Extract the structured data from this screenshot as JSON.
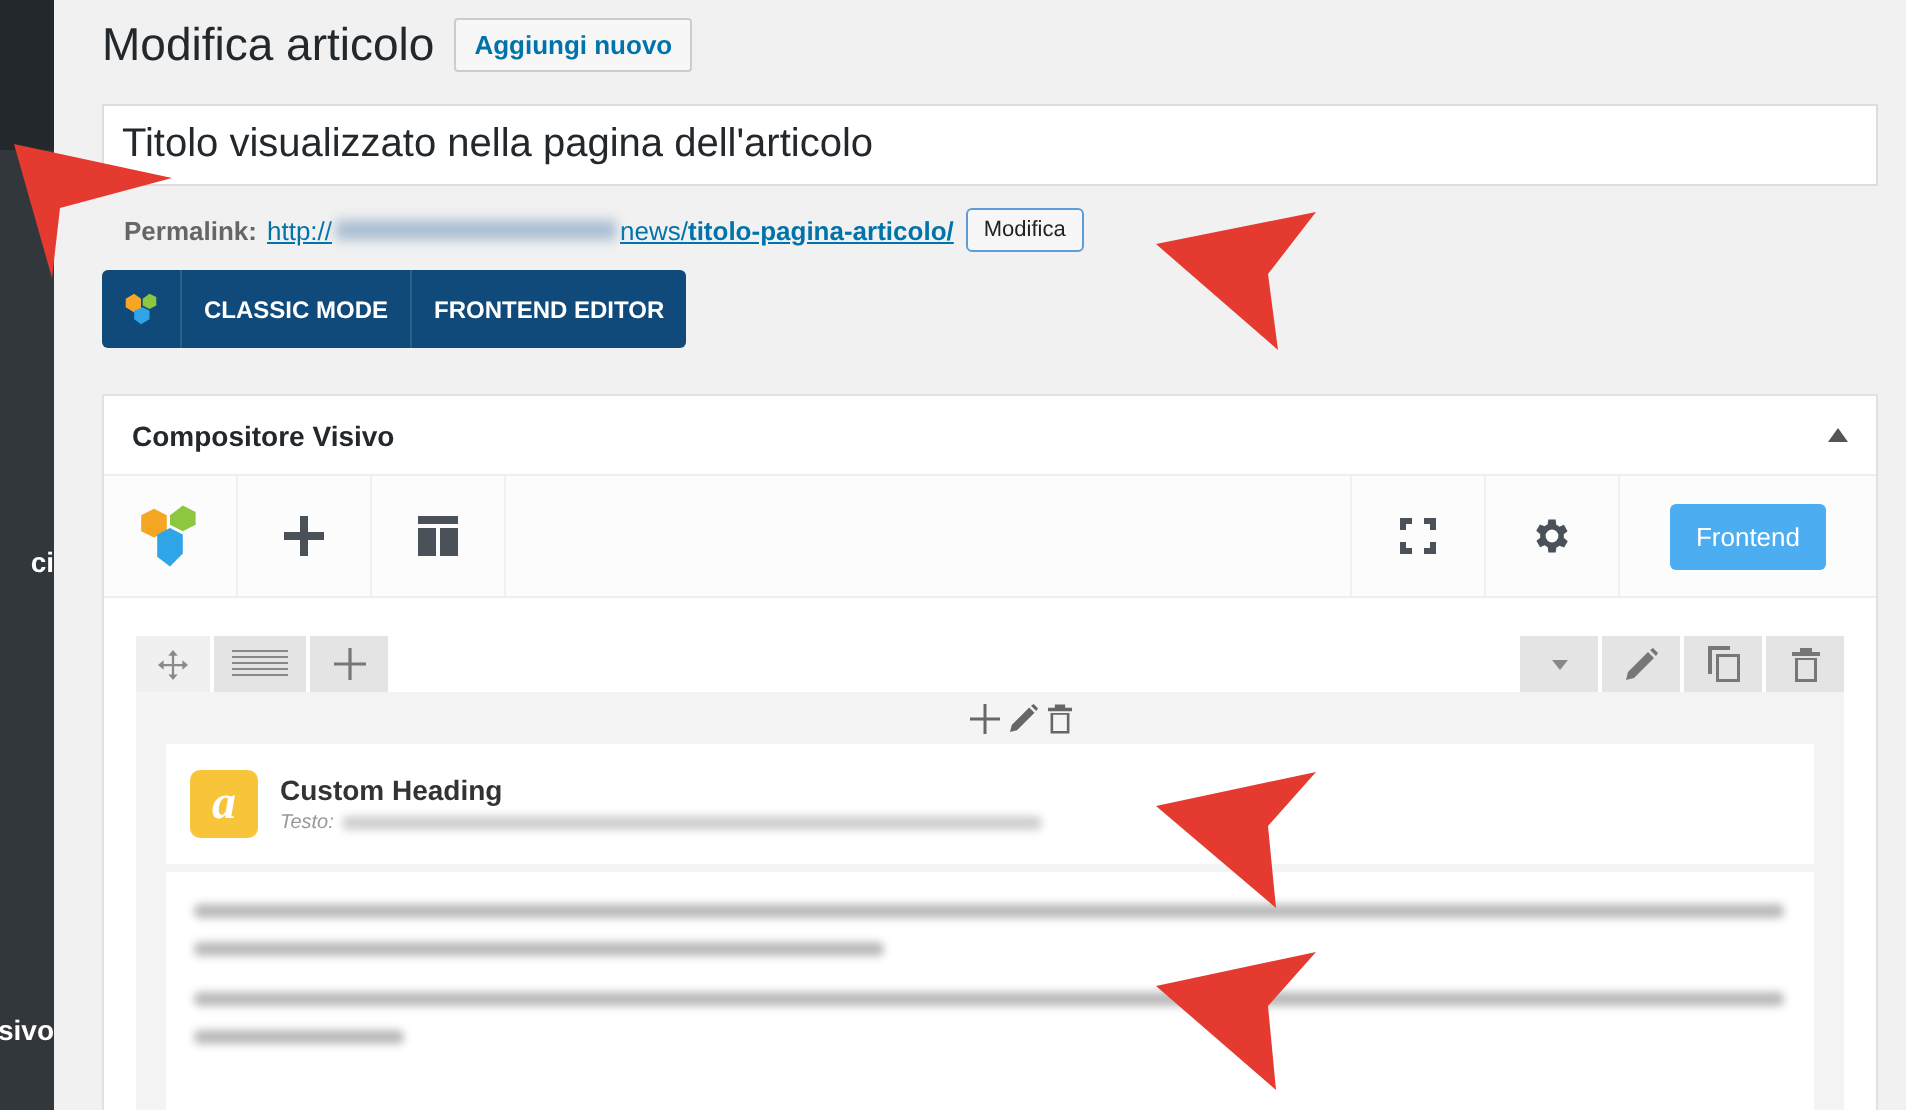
{
  "sidebar": {
    "items": [
      {
        "label": "ci"
      },
      {
        "label": "sivo"
      }
    ]
  },
  "page_title": "Modifica articolo",
  "add_new_button": "Aggiungi nuovo",
  "post_title": {
    "value": "Titolo visualizzato nella pagina dell'articolo"
  },
  "permalink": {
    "label": "Permalink:",
    "prefix": "http://",
    "path": "news/",
    "slug": "titolo-pagina-articolo/",
    "edit_button": "Modifica"
  },
  "editor_switch": {
    "buttons": [
      "CLASSIC MODE",
      "FRONTEND EDITOR"
    ]
  },
  "panel": {
    "title": "Compositore Visivo",
    "expanded": true,
    "frontend_button": "Frontend"
  },
  "element": {
    "title": "Custom Heading",
    "icon_letter": "a",
    "subtitle_label": "Testo:"
  }
}
